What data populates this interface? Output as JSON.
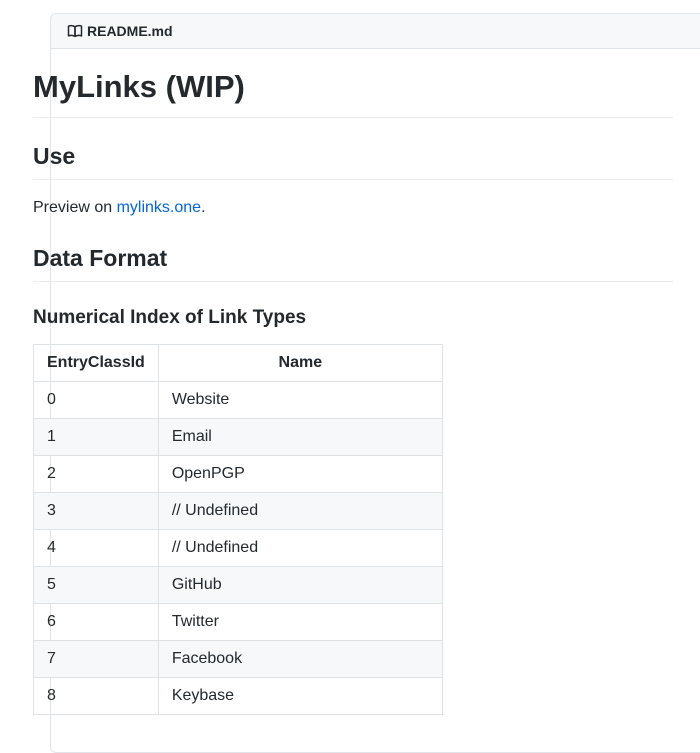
{
  "header": {
    "title": "README.md",
    "icon": "book-icon"
  },
  "readme": {
    "title": "MyLinks (WIP)",
    "use_heading": "Use",
    "preview_prefix": "Preview on ",
    "preview_link": "mylinks.one",
    "preview_suffix": ".",
    "data_format_heading": "Data Format",
    "link_types_heading": "Numerical Index of Link Types"
  },
  "table": {
    "headers": [
      "EntryClassId",
      "Name"
    ],
    "rows": [
      [
        "0",
        "Website"
      ],
      [
        "1",
        "Email"
      ],
      [
        "2",
        "OpenPGP"
      ],
      [
        "3",
        "// Undefined"
      ],
      [
        "4",
        "// Undefined"
      ],
      [
        "5",
        "GitHub"
      ],
      [
        "6",
        "Twitter"
      ],
      [
        "7",
        "Facebook"
      ],
      [
        "8",
        "Keybase"
      ]
    ]
  },
  "colors": {
    "link": "#0366d6",
    "text": "#24292e",
    "border": "#dfe2e5",
    "stripe": "#f6f8fa"
  }
}
